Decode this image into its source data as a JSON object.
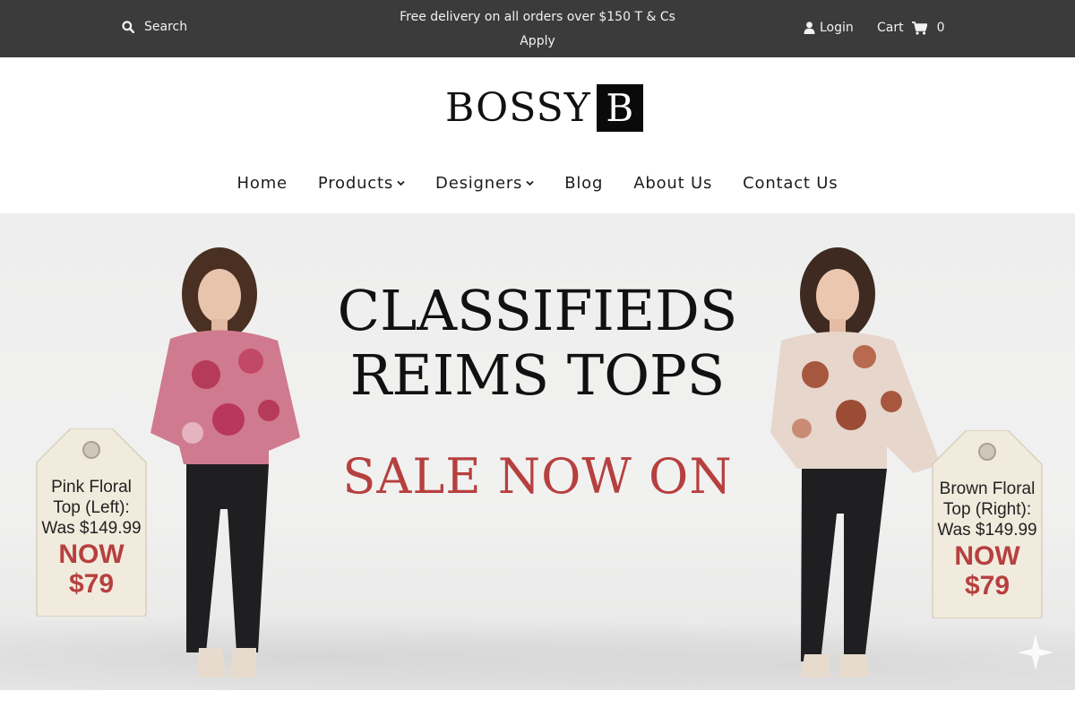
{
  "topbar": {
    "search_label": "Search",
    "promo_line1": "Free delivery on all orders over $150 T & Cs",
    "promo_line2": "Apply",
    "login_label": "Login",
    "cart_label": "Cart",
    "cart_count": "0",
    "icons": [
      "search-icon",
      "user-icon",
      "cart-icon"
    ],
    "background": "#3b3b3b",
    "text_color": "#f2f2f2"
  },
  "logo": {
    "text": "BOSSY",
    "box_letter": "B"
  },
  "nav": {
    "items": [
      {
        "label": "Home",
        "has_dropdown": false
      },
      {
        "label": "Products",
        "has_dropdown": true
      },
      {
        "label": "Designers",
        "has_dropdown": true
      },
      {
        "label": "Blog",
        "has_dropdown": false
      },
      {
        "label": "About Us",
        "has_dropdown": false
      },
      {
        "label": "Contact Us",
        "has_dropdown": false
      }
    ]
  },
  "hero": {
    "title_line1": "CLASSIFIEDS",
    "title_line2": "REIMS TOPS",
    "sale_text": "SALE NOW ON",
    "sale_color": "#b6403f",
    "tags": [
      {
        "line1": "Pink Floral",
        "line2": "Top (Left):",
        "line3": "Was $149.99",
        "now_label": "NOW",
        "now_price": "$79"
      },
      {
        "line1": "Brown Floral",
        "line2": "Top (Right):",
        "line3": "Was $149.99",
        "now_label": "NOW",
        "now_price": "$79"
      }
    ]
  }
}
